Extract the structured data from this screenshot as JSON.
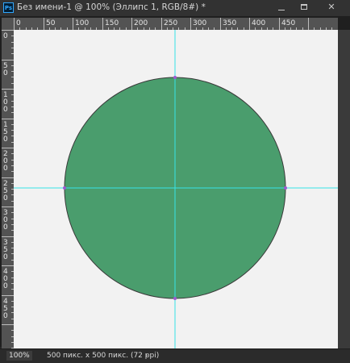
{
  "window": {
    "app_icon_text": "Ps",
    "title": "Без имени-1 @ 100% (Эллипс 1, RGB/8#) *",
    "minimize_label": "",
    "maximize_label": "",
    "close_label": "✕"
  },
  "rulers": {
    "top_labels": [
      "0",
      "50",
      "100",
      "150",
      "200",
      "250",
      "300",
      "350",
      "400",
      "450"
    ],
    "left_labels": [
      "0",
      "50",
      "100",
      "150",
      "200",
      "250",
      "300",
      "350",
      "400",
      "450"
    ]
  },
  "document": {
    "shape_name": "Эллипс 1",
    "shape_fill": "#4a9d6d",
    "guide_color": "#36e3e6",
    "anchor_color": "#9b59d0"
  },
  "status": {
    "zoom": "100%",
    "doc_info": "500 пикс. x 500 пикс. (72 ppi)",
    "arrow": "›"
  }
}
